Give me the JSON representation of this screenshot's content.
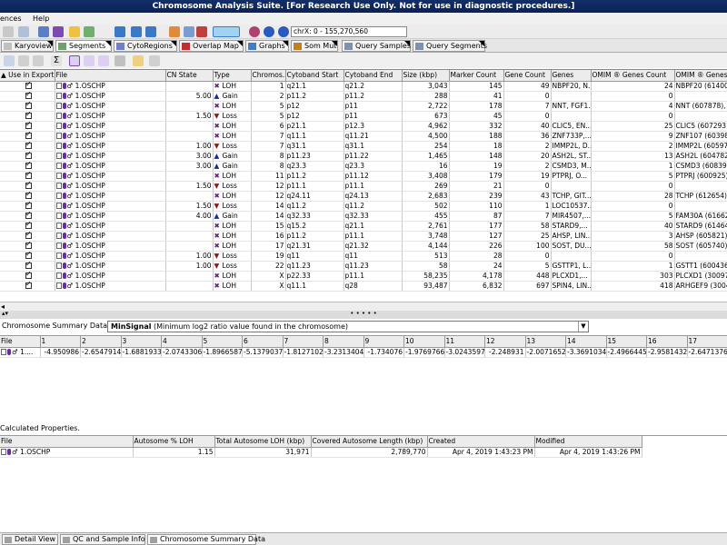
{
  "title": "Chromosome Analysis Suite. [For Research Use Only. Not for use in diagnostic procedures.]",
  "menu": [
    "ences",
    "Help"
  ],
  "region": "chrX: 0 - 155,270,560",
  "tabs": [
    "Karyoview",
    "Segments",
    "CytoRegions",
    "Overlap Map",
    "Graphs",
    "Som Mut",
    "Query Samples",
    "Query Segments"
  ],
  "segments": {
    "headers": [
      "▲ Use in Export",
      "File",
      "CN State",
      "Type",
      "Chromos...",
      "Cytoband Start",
      "Cytoband End",
      "Size (kbp)",
      "Marker Count",
      "Gene Count",
      "Genes",
      "OMIM ® Genes Count",
      "OMIM ® Genes"
    ],
    "rows": [
      [
        "1.OSCHP",
        "",
        "LOH",
        "1",
        "q21.1",
        "q21.2",
        "3,043",
        "145",
        "49",
        "NBPF20, N...",
        "24",
        "NBPF20 (614007)"
      ],
      [
        "1.OSCHP",
        "5.00",
        "Gain",
        "2",
        "p11.2",
        "p11.2",
        "288",
        "41",
        "0",
        "",
        "0",
        ""
      ],
      [
        "1.OSCHP",
        "",
        "LOH",
        "5",
        "p12",
        "p11",
        "2,722",
        "178",
        "7",
        "NNT, FGF1...",
        "4",
        "NNT (607878), FG"
      ],
      [
        "1.OSCHP",
        "1.50",
        "Loss",
        "5",
        "p12",
        "p11",
        "673",
        "45",
        "0",
        "",
        "0",
        ""
      ],
      [
        "1.OSCHP",
        "",
        "LOH",
        "6",
        "p21.1",
        "p12.3",
        "4,962",
        "332",
        "40",
        "CLIC5, EN...",
        "25",
        "CLIC5 (607293), E"
      ],
      [
        "1.OSCHP",
        "",
        "LOH",
        "7",
        "q11.1",
        "q11.21",
        "4,500",
        "188",
        "36",
        "ZNF733P,...",
        "9",
        "ZNF107 (603989),"
      ],
      [
        "1.OSCHP",
        "1.00",
        "Loss",
        "7",
        "q31.1",
        "q31.1",
        "254",
        "18",
        "2",
        "IMMP2L, D...",
        "2",
        "IMMP2L (605977)"
      ],
      [
        "1.OSCHP",
        "3.00",
        "Gain",
        "8",
        "p11.23",
        "p11.22",
        "1,465",
        "148",
        "20",
        "ASH2L, ST...",
        "13",
        "ASH2L (604782),"
      ],
      [
        "1.OSCHP",
        "3.00",
        "Gain",
        "8",
        "q23.3",
        "q23.3",
        "16",
        "19",
        "2",
        "CSMD3, M...",
        "1",
        "CSMD3 (608399)"
      ],
      [
        "1.OSCHP",
        "",
        "LOH",
        "11",
        "p11.2",
        "p11.12",
        "3,408",
        "179",
        "19",
        "PTPRJ, O...",
        "5",
        "PTPRJ (600925), F"
      ],
      [
        "1.OSCHP",
        "1.50",
        "Loss",
        "12",
        "p11.1",
        "p11.1",
        "269",
        "21",
        "0",
        "",
        "0",
        ""
      ],
      [
        "1.OSCHP",
        "",
        "LOH",
        "12",
        "q24.11",
        "q24.13",
        "2,683",
        "239",
        "43",
        "TCHP, GIT...",
        "28",
        "TCHP (612654), G"
      ],
      [
        "1.OSCHP",
        "1.50",
        "Loss",
        "14",
        "q11.2",
        "q11.2",
        "502",
        "110",
        "1",
        "LOC10537...",
        "0",
        ""
      ],
      [
        "1.OSCHP",
        "4.00",
        "Gain",
        "14",
        "q32.33",
        "q32.33",
        "455",
        "87",
        "7",
        "MIR4507,...",
        "5",
        "FAM30A (616623)"
      ],
      [
        "1.OSCHP",
        "",
        "LOH",
        "15",
        "q15.2",
        "q21.1",
        "2,761",
        "177",
        "58",
        "STARD9,...",
        "40",
        "STARD9 (614642)"
      ],
      [
        "1.OSCHP",
        "",
        "LOH",
        "16",
        "p11.2",
        "p11.1",
        "3,748",
        "127",
        "25",
        "AHSP, LIN...",
        "3",
        "AHSP (605821), Z"
      ],
      [
        "1.OSCHP",
        "",
        "LOH",
        "17",
        "q21.31",
        "q21.32",
        "4,144",
        "226",
        "100",
        "SOST, DU...",
        "58",
        "SOST (605740), D"
      ],
      [
        "1.OSCHP",
        "1.00",
        "Loss",
        "19",
        "q11",
        "q11",
        "513",
        "28",
        "0",
        "",
        "0",
        ""
      ],
      [
        "1.OSCHP",
        "1.00",
        "Loss",
        "22",
        "q11.23",
        "q11.23",
        "58",
        "24",
        "5",
        "GSTTP1, L...",
        "1",
        "GSTT1 (600436)"
      ],
      [
        "1.OSCHP",
        "",
        "LOH",
        "X",
        "p22.33",
        "p11.1",
        "58,235",
        "4,178",
        "448",
        "PLCXD1,...",
        "303",
        "PLCXD1 (300974)"
      ],
      [
        "1.OSCHP",
        "",
        "LOH",
        "X",
        "q11.1",
        "q28",
        "93,487",
        "6,832",
        "697",
        "SPIN4, LIN...",
        "418",
        "ARHGEF9 (30042"
      ]
    ]
  },
  "summary": {
    "label": "Chromosome Summary Data Type:",
    "selected_bold": "MinSignal",
    "selected_rest": "(Minimum log2 ratio value found in the chromosome)",
    "headers": [
      "File",
      "1",
      "2",
      "3",
      "4",
      "5",
      "6",
      "7",
      "8",
      "9",
      "10",
      "11",
      "12",
      "13",
      "14",
      "15",
      "16",
      "17"
    ],
    "row_file": "1....",
    "values": [
      "-4.950986",
      "-2.6547914",
      "-1.6881933",
      "-2.0743306",
      "-1.8966587",
      "-5.1379037",
      "-1.8127102",
      "-3.2313404",
      "-1.734076",
      "-1.9769766",
      "-3.0243597",
      "-2.248931",
      "-2.0071652",
      "-3.3691034",
      "-2.4966445",
      "-2.9581432",
      "-2.6471376"
    ]
  },
  "calc": {
    "label": "Calculated Properties.",
    "headers": [
      "File",
      "Autosome % LOH",
      "Total Autosome LOH (kbp)",
      "Covered Autosome Length (kbp)",
      "Created",
      "Modified"
    ],
    "row": [
      "1.OSCHP",
      "1.15",
      "31,971",
      "2,789,770",
      "Apr 4, 2019 1:43:23 PM",
      "Apr 4, 2019 1:43:26 PM"
    ]
  },
  "bottom_tabs": [
    "Detail View",
    "QC and Sample Info",
    "Chromosome Summary Data"
  ],
  "colors": {
    "loh": "#6a1b8a",
    "gain": "#1a2a8a",
    "loss": "#8a1a1a",
    "title_bg": "#0a2254"
  }
}
